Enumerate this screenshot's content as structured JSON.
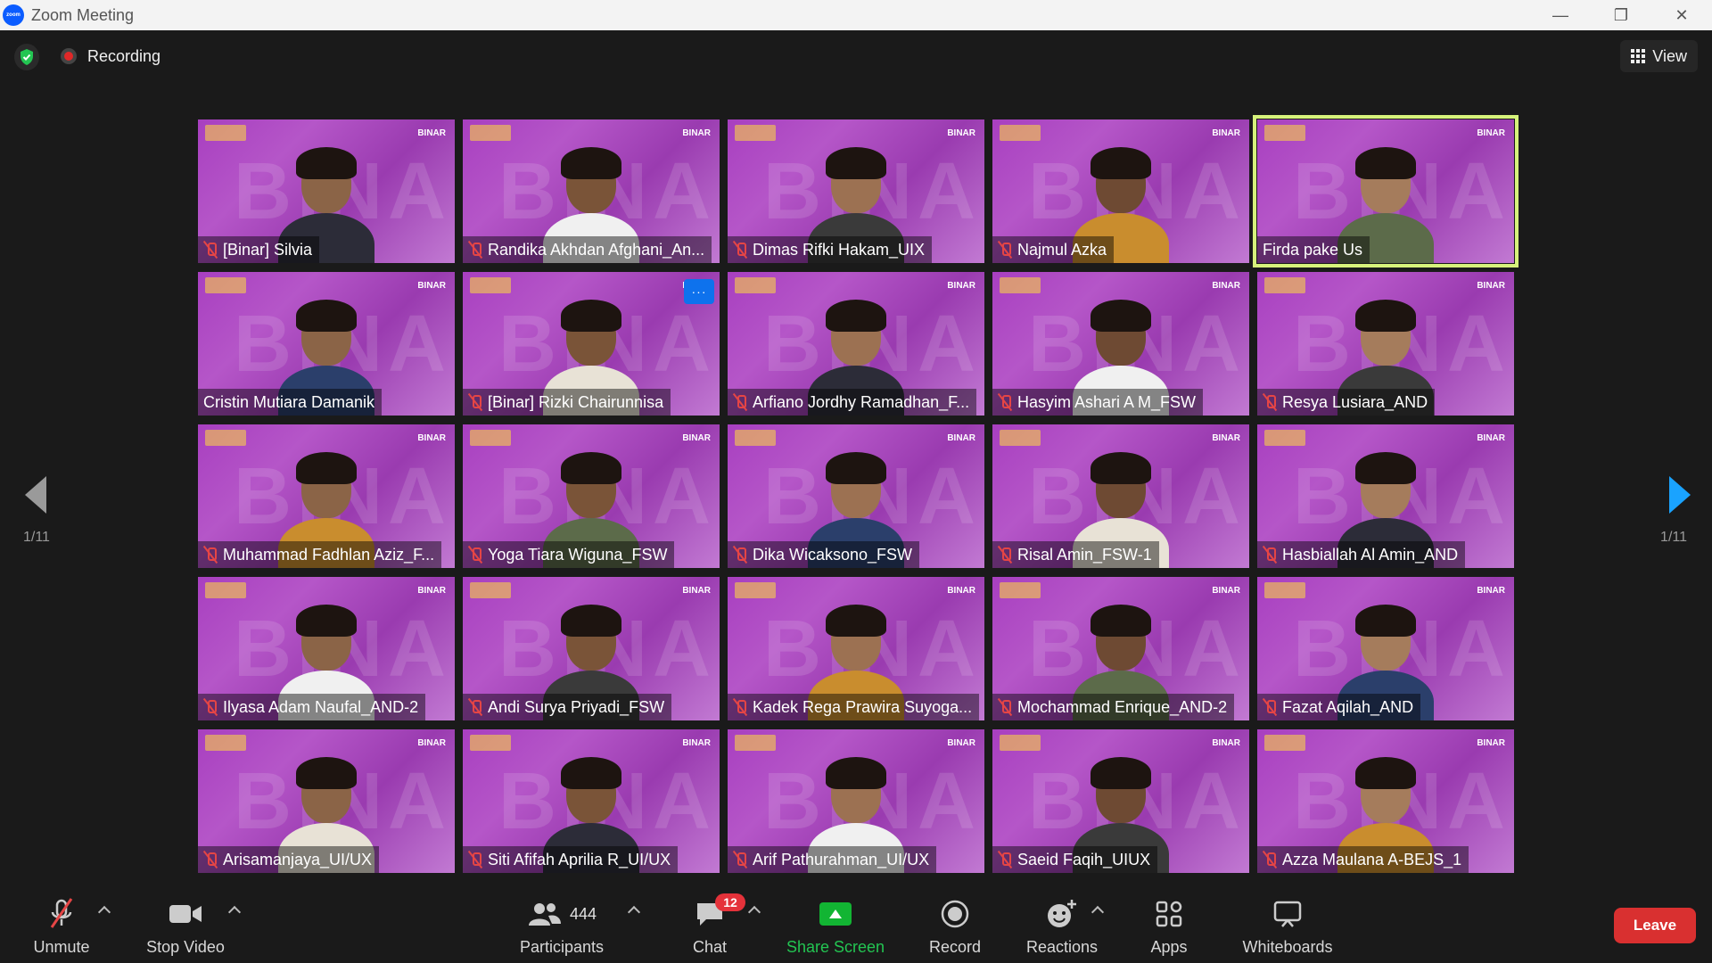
{
  "window": {
    "title": "Zoom Meeting",
    "logo_text": "zoom"
  },
  "topbar": {
    "recording_label": "Recording",
    "view_label": "View"
  },
  "gallery": {
    "page_indicator_left": "1/11",
    "page_indicator_right": "1/11",
    "participants": [
      {
        "name": "[Binar] Silvia",
        "muted": true
      },
      {
        "name": "Randika Akhdan Afghani_An...",
        "muted": true
      },
      {
        "name": "Dimas Rifki Hakam_UIX",
        "muted": true
      },
      {
        "name": "Najmul Azka",
        "muted": true
      },
      {
        "name": "Firda pake Us",
        "muted": false,
        "active_speaker": true
      },
      {
        "name": "Cristin Mutiara Damanik",
        "muted": false
      },
      {
        "name": "[Binar] Rizki Chairunnisa",
        "muted": true
      },
      {
        "name": "Arfiano Jordhy Ramadhan_F...",
        "muted": true
      },
      {
        "name": "Hasyim Ashari A M_FSW",
        "muted": true
      },
      {
        "name": "Resya Lusiara_AND",
        "muted": true
      },
      {
        "name": "Muhammad Fadhlan Aziz_F...",
        "muted": true
      },
      {
        "name": "Yoga Tiara Wiguna_FSW",
        "muted": true
      },
      {
        "name": "Dika Wicaksono_FSW",
        "muted": true
      },
      {
        "name": "Risal Amin_FSW-1",
        "muted": true
      },
      {
        "name": "Hasbiallah Al Amin_AND",
        "muted": true
      },
      {
        "name": "Ilyasa Adam Naufal_AND-2",
        "muted": true
      },
      {
        "name": "Andi Surya Priyadi_FSW",
        "muted": true
      },
      {
        "name": "Kadek Rega Prawira Suyoga...",
        "muted": true
      },
      {
        "name": "Mochammad Enrique_AND-2",
        "muted": true
      },
      {
        "name": "Fazat Aqilah_AND",
        "muted": true
      },
      {
        "name": "Arisamanjaya_UI/UX",
        "muted": true
      },
      {
        "name": "Siti Afifah Aprilia R_UI/UX",
        "muted": true
      },
      {
        "name": "Arif Pathurahman_UI/UX",
        "muted": true
      },
      {
        "name": "Saeid Faqih_UIUX",
        "muted": true
      },
      {
        "name": "Azza Maulana A-BEJS_1",
        "muted": true
      }
    ],
    "tile_brand": "BINAR",
    "tile_bg_word": "BINAR",
    "more_button_label": "···"
  },
  "toolbar": {
    "unmute_label": "Unmute",
    "stop_video_label": "Stop Video",
    "participants_label": "Participants",
    "participants_count": "444",
    "chat_label": "Chat",
    "chat_badge": "12",
    "share_screen_label": "Share Screen",
    "record_label": "Record",
    "reactions_label": "Reactions",
    "apps_label": "Apps",
    "whiteboards_label": "Whiteboards",
    "leave_label": "Leave"
  },
  "colors": {
    "accent_blue": "#0e72ed",
    "share_green": "#12b533",
    "leave_red": "#d93030",
    "muted_red": "#e54545",
    "active_speaker": "#d7f27b",
    "tile_purple": "#a83fc0"
  },
  "icons": [
    "shield-icon",
    "recording-icon",
    "grid-view-icon",
    "muted-mic-icon",
    "mic-icon",
    "video-icon",
    "participants-icon",
    "chat-icon",
    "share-icon",
    "record-icon",
    "reactions-icon",
    "apps-icon",
    "whiteboard-icon"
  ]
}
